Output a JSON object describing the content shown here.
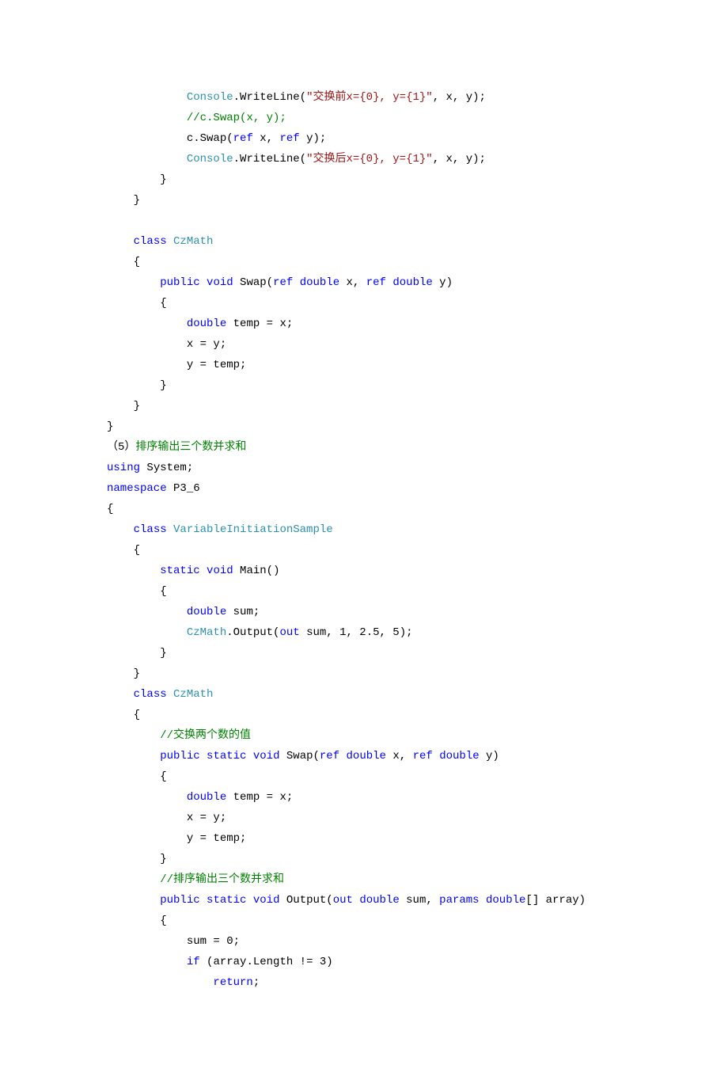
{
  "code": {
    "tokens": [
      {
        "indent": 12,
        "parts": [
          {
            "c": "typ",
            "t": "Console"
          },
          {
            "c": "plain",
            "t": ".WriteLine("
          },
          {
            "c": "str",
            "t": "\"交换前x={0}, y={1}\""
          },
          {
            "c": "plain",
            "t": ", x, y);"
          }
        ]
      },
      {
        "indent": 12,
        "parts": [
          {
            "c": "cmt",
            "t": "//c.Swap(x, y);"
          }
        ]
      },
      {
        "indent": 12,
        "parts": [
          {
            "c": "plain",
            "t": "c.Swap("
          },
          {
            "c": "kw",
            "t": "ref"
          },
          {
            "c": "plain",
            "t": " x, "
          },
          {
            "c": "kw",
            "t": "ref"
          },
          {
            "c": "plain",
            "t": " y);"
          }
        ]
      },
      {
        "indent": 12,
        "parts": [
          {
            "c": "typ",
            "t": "Console"
          },
          {
            "c": "plain",
            "t": ".WriteLine("
          },
          {
            "c": "str",
            "t": "\"交换后x={0}, y={1}\""
          },
          {
            "c": "plain",
            "t": ", x, y);"
          }
        ]
      },
      {
        "indent": 8,
        "parts": [
          {
            "c": "plain",
            "t": "}"
          }
        ]
      },
      {
        "indent": 4,
        "parts": [
          {
            "c": "plain",
            "t": "}"
          }
        ]
      },
      {
        "indent": 0,
        "parts": [
          {
            "c": "plain",
            "t": ""
          }
        ]
      },
      {
        "indent": 4,
        "parts": [
          {
            "c": "kw",
            "t": "class"
          },
          {
            "c": "plain",
            "t": " "
          },
          {
            "c": "typ",
            "t": "CzMath"
          }
        ]
      },
      {
        "indent": 4,
        "parts": [
          {
            "c": "plain",
            "t": "{"
          }
        ]
      },
      {
        "indent": 8,
        "parts": [
          {
            "c": "kw",
            "t": "public"
          },
          {
            "c": "plain",
            "t": " "
          },
          {
            "c": "kw",
            "t": "void"
          },
          {
            "c": "plain",
            "t": " Swap("
          },
          {
            "c": "kw",
            "t": "ref"
          },
          {
            "c": "plain",
            "t": " "
          },
          {
            "c": "kw",
            "t": "double"
          },
          {
            "c": "plain",
            "t": " x, "
          },
          {
            "c": "kw",
            "t": "ref"
          },
          {
            "c": "plain",
            "t": " "
          },
          {
            "c": "kw",
            "t": "double"
          },
          {
            "c": "plain",
            "t": " y)"
          }
        ]
      },
      {
        "indent": 8,
        "parts": [
          {
            "c": "plain",
            "t": "{"
          }
        ]
      },
      {
        "indent": 12,
        "parts": [
          {
            "c": "kw",
            "t": "double"
          },
          {
            "c": "plain",
            "t": " temp = x;"
          }
        ]
      },
      {
        "indent": 12,
        "parts": [
          {
            "c": "plain",
            "t": "x = y;"
          }
        ]
      },
      {
        "indent": 12,
        "parts": [
          {
            "c": "plain",
            "t": "y = temp;"
          }
        ]
      },
      {
        "indent": 8,
        "parts": [
          {
            "c": "plain",
            "t": "}"
          }
        ]
      },
      {
        "indent": 4,
        "parts": [
          {
            "c": "plain",
            "t": "}"
          }
        ]
      },
      {
        "indent": 0,
        "parts": [
          {
            "c": "plain",
            "t": "}"
          }
        ]
      },
      {
        "indent": 0,
        "parts": [
          {
            "c": "plain",
            "t": "（5）"
          },
          {
            "c": "cmt",
            "t": "排序输出三个数并求和"
          }
        ]
      },
      {
        "indent": 0,
        "parts": [
          {
            "c": "kw",
            "t": "using"
          },
          {
            "c": "plain",
            "t": " System;"
          }
        ]
      },
      {
        "indent": 0,
        "parts": [
          {
            "c": "kw",
            "t": "namespace"
          },
          {
            "c": "plain",
            "t": " P3_6"
          }
        ]
      },
      {
        "indent": 0,
        "parts": [
          {
            "c": "plain",
            "t": "{"
          }
        ]
      },
      {
        "indent": 4,
        "parts": [
          {
            "c": "kw",
            "t": "class"
          },
          {
            "c": "plain",
            "t": " "
          },
          {
            "c": "typ",
            "t": "VariableInitiationSample"
          }
        ]
      },
      {
        "indent": 4,
        "parts": [
          {
            "c": "plain",
            "t": "{"
          }
        ]
      },
      {
        "indent": 8,
        "parts": [
          {
            "c": "kw",
            "t": "static"
          },
          {
            "c": "plain",
            "t": " "
          },
          {
            "c": "kw",
            "t": "void"
          },
          {
            "c": "plain",
            "t": " Main()"
          }
        ]
      },
      {
        "indent": 8,
        "parts": [
          {
            "c": "plain",
            "t": "{"
          }
        ]
      },
      {
        "indent": 12,
        "parts": [
          {
            "c": "kw",
            "t": "double"
          },
          {
            "c": "plain",
            "t": " sum;"
          }
        ]
      },
      {
        "indent": 12,
        "parts": [
          {
            "c": "typ",
            "t": "CzMath"
          },
          {
            "c": "plain",
            "t": ".Output("
          },
          {
            "c": "kw",
            "t": "out"
          },
          {
            "c": "plain",
            "t": " sum, 1, 2.5, 5);"
          }
        ]
      },
      {
        "indent": 8,
        "parts": [
          {
            "c": "plain",
            "t": "}"
          }
        ]
      },
      {
        "indent": 4,
        "parts": [
          {
            "c": "plain",
            "t": "}"
          }
        ]
      },
      {
        "indent": 4,
        "parts": [
          {
            "c": "kw",
            "t": "class"
          },
          {
            "c": "plain",
            "t": " "
          },
          {
            "c": "typ",
            "t": "CzMath"
          }
        ]
      },
      {
        "indent": 4,
        "parts": [
          {
            "c": "plain",
            "t": "{"
          }
        ]
      },
      {
        "indent": 8,
        "parts": [
          {
            "c": "cmt",
            "t": "//交换两个数的值"
          }
        ]
      },
      {
        "indent": 8,
        "parts": [
          {
            "c": "kw",
            "t": "public"
          },
          {
            "c": "plain",
            "t": " "
          },
          {
            "c": "kw",
            "t": "static"
          },
          {
            "c": "plain",
            "t": " "
          },
          {
            "c": "kw",
            "t": "void"
          },
          {
            "c": "plain",
            "t": " Swap("
          },
          {
            "c": "kw",
            "t": "ref"
          },
          {
            "c": "plain",
            "t": " "
          },
          {
            "c": "kw",
            "t": "double"
          },
          {
            "c": "plain",
            "t": " x, "
          },
          {
            "c": "kw",
            "t": "ref"
          },
          {
            "c": "plain",
            "t": " "
          },
          {
            "c": "kw",
            "t": "double"
          },
          {
            "c": "plain",
            "t": " y)"
          }
        ]
      },
      {
        "indent": 8,
        "parts": [
          {
            "c": "plain",
            "t": "{"
          }
        ]
      },
      {
        "indent": 12,
        "parts": [
          {
            "c": "kw",
            "t": "double"
          },
          {
            "c": "plain",
            "t": " temp = x;"
          }
        ]
      },
      {
        "indent": 12,
        "parts": [
          {
            "c": "plain",
            "t": "x = y;"
          }
        ]
      },
      {
        "indent": 12,
        "parts": [
          {
            "c": "plain",
            "t": "y = temp;"
          }
        ]
      },
      {
        "indent": 8,
        "parts": [
          {
            "c": "plain",
            "t": "}"
          }
        ]
      },
      {
        "indent": 8,
        "parts": [
          {
            "c": "cmt",
            "t": "//排序输出三个数并求和"
          }
        ]
      },
      {
        "indent": 8,
        "parts": [
          {
            "c": "kw",
            "t": "public"
          },
          {
            "c": "plain",
            "t": " "
          },
          {
            "c": "kw",
            "t": "static"
          },
          {
            "c": "plain",
            "t": " "
          },
          {
            "c": "kw",
            "t": "void"
          },
          {
            "c": "plain",
            "t": " Output("
          },
          {
            "c": "kw",
            "t": "out"
          },
          {
            "c": "plain",
            "t": " "
          },
          {
            "c": "kw",
            "t": "double"
          },
          {
            "c": "plain",
            "t": " sum, "
          },
          {
            "c": "kw",
            "t": "params"
          },
          {
            "c": "plain",
            "t": " "
          },
          {
            "c": "kw",
            "t": "double"
          },
          {
            "c": "plain",
            "t": "[] array)"
          }
        ]
      },
      {
        "indent": 8,
        "parts": [
          {
            "c": "plain",
            "t": "{"
          }
        ]
      },
      {
        "indent": 12,
        "parts": [
          {
            "c": "plain",
            "t": "sum = 0;"
          }
        ]
      },
      {
        "indent": 12,
        "parts": [
          {
            "c": "kw",
            "t": "if"
          },
          {
            "c": "plain",
            "t": " (array.Length != 3)"
          }
        ]
      },
      {
        "indent": 16,
        "parts": [
          {
            "c": "kw",
            "t": "return"
          },
          {
            "c": "plain",
            "t": ";"
          }
        ]
      }
    ]
  }
}
